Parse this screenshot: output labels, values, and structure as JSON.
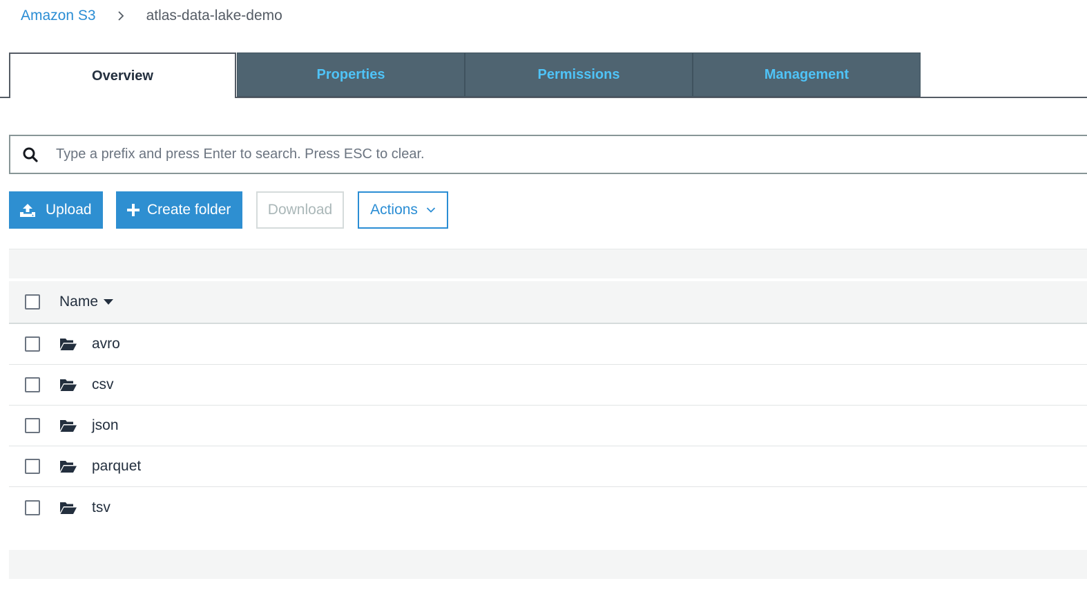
{
  "breadcrumb": {
    "root": "Amazon S3",
    "current": "atlas-data-lake-demo"
  },
  "tabs": [
    {
      "label": "Overview",
      "active": true
    },
    {
      "label": "Properties",
      "active": false
    },
    {
      "label": "Permissions",
      "active": false
    },
    {
      "label": "Management",
      "active": false
    }
  ],
  "search": {
    "placeholder": "Type a prefix and press Enter to search. Press ESC to clear.",
    "value": ""
  },
  "toolbar": {
    "upload": "Upload",
    "create_folder": "Create folder",
    "download": "Download",
    "actions": "Actions"
  },
  "table": {
    "column_name": "Name",
    "rows": [
      {
        "name": "avro",
        "type": "folder"
      },
      {
        "name": "csv",
        "type": "folder"
      },
      {
        "name": "json",
        "type": "folder"
      },
      {
        "name": "parquet",
        "type": "folder"
      },
      {
        "name": "tsv",
        "type": "folder"
      }
    ]
  },
  "colors": {
    "link": "#2a8dd4",
    "primary_button": "#2e8fd1",
    "tab_inactive_bg": "#4f6471",
    "tab_inactive_text": "#4fc3f7"
  },
  "icons": {
    "breadcrumb_separator": "chevron-right-icon",
    "search": "search-icon",
    "upload": "upload-icon",
    "create_folder": "plus-icon",
    "actions": "chevron-down-icon",
    "sort": "caret-down-icon",
    "row": "folder-open-icon"
  }
}
